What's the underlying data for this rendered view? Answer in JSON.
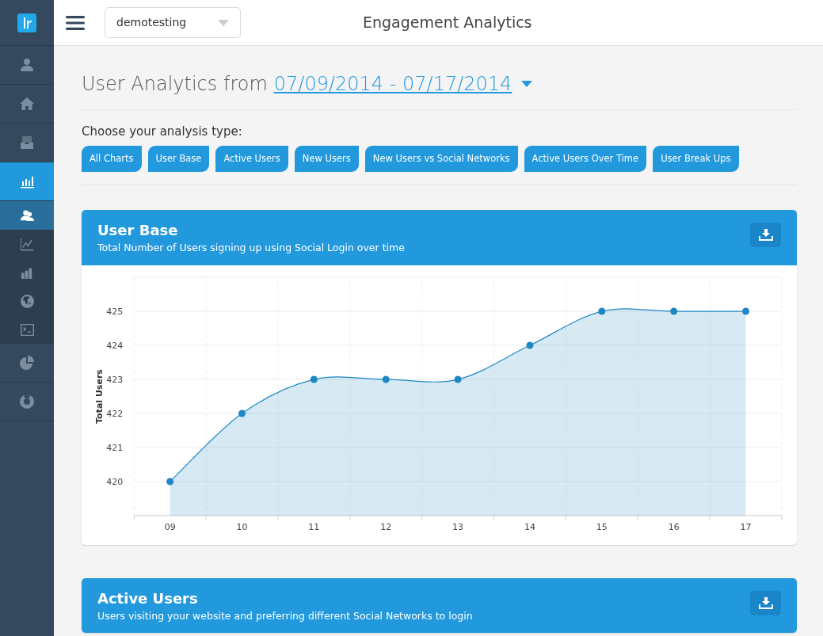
{
  "topbar": {
    "account_select": "demotesting",
    "title": "Engagement Analytics"
  },
  "sidebar": {
    "items": [
      {
        "selected": false
      },
      {
        "selected": false
      },
      {
        "selected": false
      },
      {
        "selected": true,
        "children": [
          {
            "selected": true
          },
          {
            "selected": false
          },
          {
            "selected": false
          },
          {
            "selected": false
          },
          {
            "selected": false
          }
        ]
      },
      {
        "selected": false
      },
      {
        "selected": false
      }
    ]
  },
  "heading": {
    "text": "User Analytics from",
    "date_range": "07/09/2014 - 07/17/2014"
  },
  "analysis": {
    "label": "Choose your analysis type:",
    "buttons": [
      "All Charts",
      "User Base",
      "Active Users",
      "New Users",
      "New Users vs Social Networks",
      "Active Users Over Time",
      "User Break Ups"
    ]
  },
  "panels": [
    {
      "title": "User Base",
      "subtitle": "Total Number of Users signing up using Social Login over time",
      "chart_data": {
        "type": "area",
        "ylabel": "Total Users",
        "categories": [
          "09",
          "10",
          "11",
          "12",
          "13",
          "14",
          "15",
          "16",
          "17"
        ],
        "grid": true,
        "series": [
          {
            "color": "#1f88c4",
            "values": [
              420,
              422,
              423,
              423,
              423,
              424,
              425,
              425,
              425
            ]
          }
        ],
        "ylim": [
          419,
          426
        ],
        "yticks": [
          420,
          421,
          422,
          423,
          424,
          425
        ]
      }
    },
    {
      "title": "Active Users",
      "subtitle": "Users visiting your website and preferring different Social Networks to login"
    }
  ]
}
